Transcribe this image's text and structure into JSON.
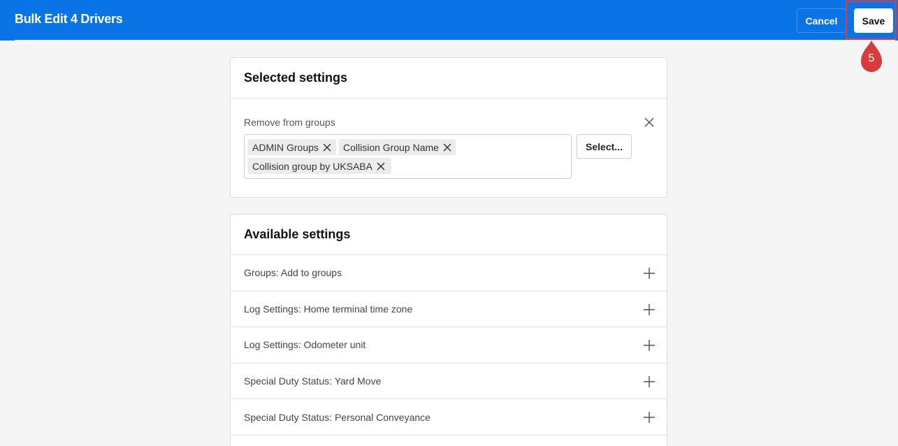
{
  "header": {
    "title": "Bulk Edit 4 Drivers",
    "cancel_label": "Cancel",
    "save_label": "Save",
    "accent_color": "#0a73e6"
  },
  "annotation": {
    "step_number": "5",
    "marker_color": "#d93a3a"
  },
  "selected_settings": {
    "title": "Selected settings",
    "field_label": "Remove from groups",
    "tags": [
      "ADMIN Groups",
      "Collision Group Name",
      "Collision group by UKSABA"
    ],
    "select_button_label": "Select..."
  },
  "available_settings": {
    "title": "Available settings",
    "items": [
      {
        "label": "Groups: Add to groups",
        "icon": "plus-icon"
      },
      {
        "label": "Log Settings: Home terminal time zone",
        "icon": "plus-icon"
      },
      {
        "label": "Log Settings: Odometer unit",
        "icon": "plus-icon"
      },
      {
        "label": "Special Duty Status: Yard Move",
        "icon": "plus-icon"
      },
      {
        "label": "Special Duty Status: Personal Conveyance",
        "icon": "plus-icon"
      }
    ]
  }
}
